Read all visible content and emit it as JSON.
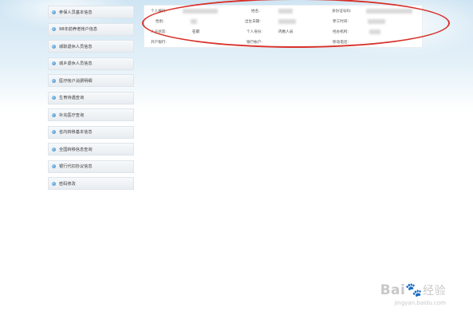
{
  "sidebar": {
    "items": [
      {
        "label": "参保人员基本信息"
      },
      {
        "label": "98年前养老帐户信息"
      },
      {
        "label": "城职退休人员信息"
      },
      {
        "label": "城乡退休人员信息"
      },
      {
        "label": "医疗帐户消费明细"
      },
      {
        "label": "生育待遇查询"
      },
      {
        "label": "补充医疗查询"
      },
      {
        "label": "省内转移基本信息"
      },
      {
        "label": "全国转移信息查询"
      },
      {
        "label": "银行代扣协议信息"
      },
      {
        "label": "密码修改"
      }
    ]
  },
  "info": {
    "personal_no_label": "个人编码:",
    "name_label": "姓名:",
    "id_card_label": "身份证号码:",
    "gender_label": "性别:",
    "birth_label": "出生日期:",
    "work_start_label": "参工时间:",
    "status_label": "人员状态:",
    "status_value": "在职",
    "identity_label": "个人身份:",
    "identity_value": "内地人员",
    "agency_label": "经办机构:",
    "account_label": "开户银行:",
    "bank_account_label": "银行帐户:",
    "transfer_label": "移动电话:"
  },
  "watermark": {
    "brand": "Bai",
    "brand_suffix": "经验",
    "url": "jingyan.baidu.com"
  }
}
